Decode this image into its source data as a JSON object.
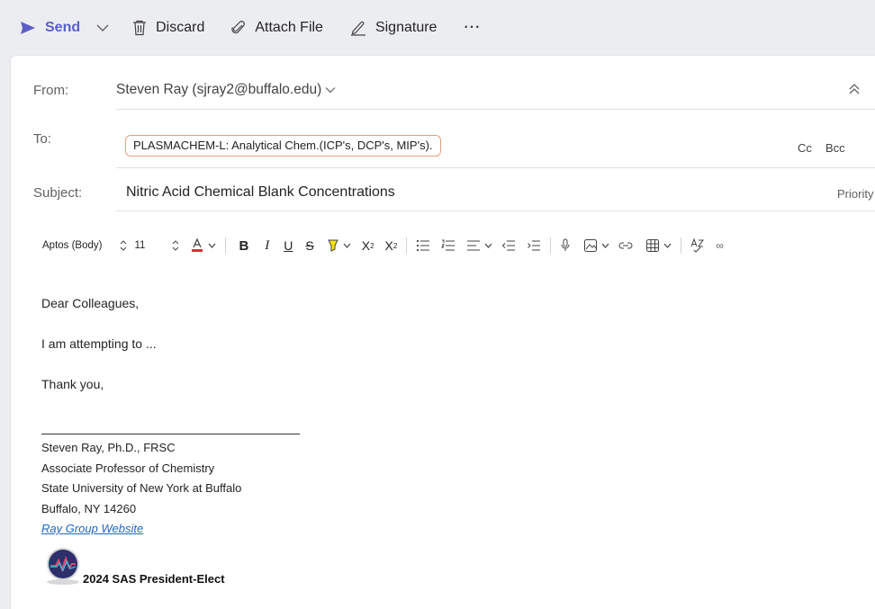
{
  "toolbar": {
    "send_label": "Send",
    "discard_label": "Discard",
    "attach_label": "Attach File",
    "signature_label": "Signature",
    "more_label": "···"
  },
  "header": {
    "from_label": "From:",
    "from_value": "Steven Ray (sjray2@buffalo.edu)",
    "to_label": "To:",
    "to_recipient": "PLASMACHEM-L: Analytical Chem.(ICP's, DCP's, MIP's).",
    "cc_label": "Cc",
    "bcc_label": "Bcc",
    "subject_label": "Subject:",
    "subject_value": "Nitric Acid Chemical Blank Concentrations",
    "priority_label": "Priority"
  },
  "format": {
    "font_name": "Aptos (Body)",
    "font_size": "11"
  },
  "body": {
    "greeting": "Dear Colleagues,",
    "line1": "I am attempting to ...",
    "closing": "Thank you,"
  },
  "signature": {
    "name": "Steven Ray, Ph.D., FRSC",
    "title": "Associate Professor of Chemistry",
    "institution": "State University of New York at Buffalo",
    "address": "Buffalo, NY 14260",
    "link": "Ray Group Website",
    "badge": "2024 SAS President-Elect"
  },
  "colors": {
    "accent": "#5b5fc7",
    "chip_border": "#e8a07a",
    "link": "#2067c4"
  }
}
